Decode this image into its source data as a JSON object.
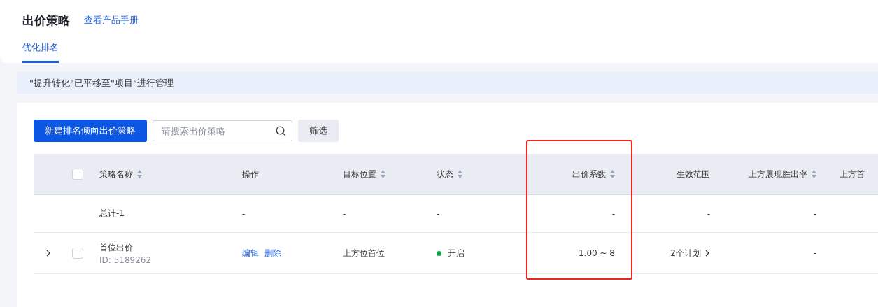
{
  "header": {
    "title": "出价策略",
    "link": "查看产品手册"
  },
  "tabs": [
    {
      "label": "优化排名",
      "selected": true
    }
  ],
  "notice": "\"提升转化\"已平移至\"项目\"进行管理",
  "toolbar": {
    "create_button": "新建排名倾向出价策略",
    "search": {
      "placeholder": "请搜索出价策略"
    },
    "filter_button": "筛选"
  },
  "table": {
    "select_all": {
      "checked": false
    },
    "columns": [
      {
        "label": "策略名称",
        "sortable": true,
        "highlighted": false
      },
      {
        "label": "操作",
        "sortable": false,
        "highlighted": false
      },
      {
        "label": "目标位置",
        "sortable": true,
        "highlighted": false
      },
      {
        "label": "状态",
        "sortable": true,
        "highlighted": false
      },
      {
        "label": "出价系数",
        "sortable": true,
        "highlighted": true
      },
      {
        "label": "生效范围",
        "sortable": false,
        "highlighted": false
      },
      {
        "label": "上方展现胜出率",
        "sortable": true,
        "highlighted": false
      },
      {
        "label": "上方首",
        "sortable": false,
        "highlighted": false
      }
    ],
    "rows": [
      {
        "kind": "total",
        "name": "总计-1",
        "actions": "-",
        "target": "-",
        "status": "-",
        "bid": "-",
        "scope": "-",
        "rate": "-"
      },
      {
        "kind": "item",
        "expanded": false,
        "checked": false,
        "name": "首位出价",
        "id": "ID: 5189262",
        "actions": [
          "编辑",
          "删除"
        ],
        "target": "上方位首位",
        "status": {
          "label": "开启",
          "on": true
        },
        "bid": "1.00 ~ 8",
        "scope": "2个计划",
        "rate": "-"
      }
    ]
  }
}
